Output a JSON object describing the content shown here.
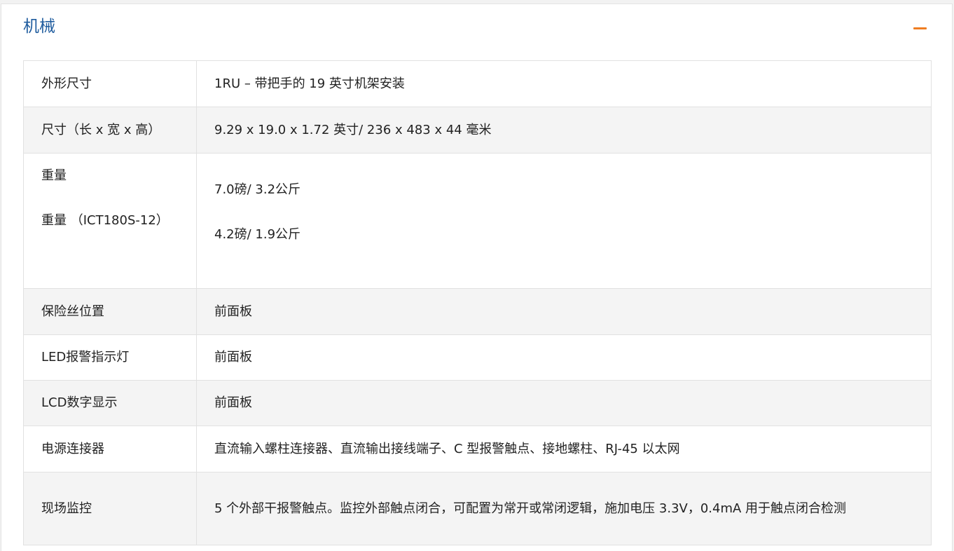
{
  "section": {
    "title": "机械",
    "collapse_icon": "minus-icon",
    "accent_color": "#ef7d22",
    "title_color": "#1f5c9e"
  },
  "specs": {
    "rows": [
      {
        "label": "外形尺寸",
        "value": "1RU – 带把手的 19 英寸机架安装"
      },
      {
        "label": "尺寸（长 x 宽 x 高）",
        "value": "9.29 x 19.0 x 1.72 英寸/ 236 x 483 x 44 毫米"
      },
      {
        "label": "重量",
        "label2": "重量 （ICT180S-12）",
        "value": "7.0磅/ 3.2公斤",
        "value2": "4.2磅/ 1.9公斤"
      },
      {
        "label": "保险丝位置",
        "value": "前面板"
      },
      {
        "label": "LED报警指示灯",
        "value": "前面板"
      },
      {
        "label": "LCD数字显示",
        "value": "前面板"
      },
      {
        "label": "电源连接器",
        "value": "直流输入螺柱连接器、直流输出接线端子、C 型报警触点、接地螺柱、RJ-45 以太网"
      },
      {
        "label": "现场监控",
        "value": "5 个外部干报警触点。监控外部触点闭合，可配置为常开或常闭逻辑，施加电压 3.3V，0.4mA 用于触点闭合检测"
      }
    ]
  }
}
